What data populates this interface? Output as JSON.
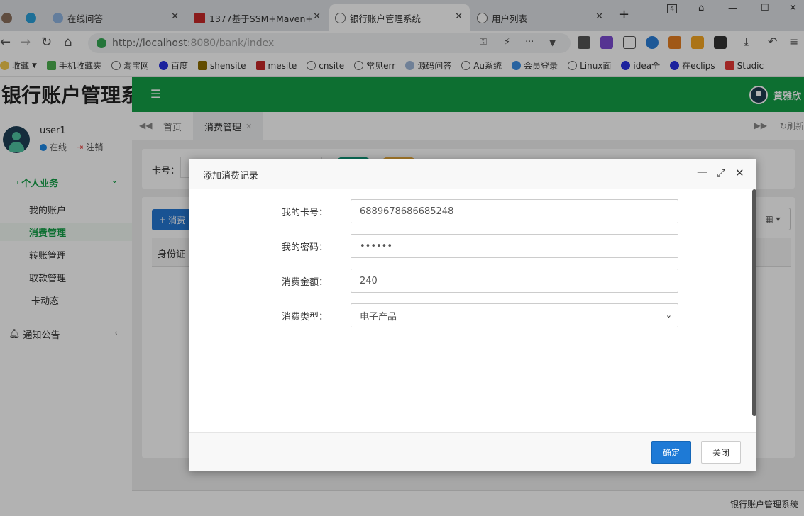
{
  "browser": {
    "tabs": [
      {
        "title": "在线问答"
      },
      {
        "title": "1377基于SSM+Maven+"
      },
      {
        "title": "银行账户管理系统"
      },
      {
        "title": "用户列表"
      }
    ],
    "tab_badge": "4",
    "url_host": "http://localhost",
    "url_rest": ":8080/bank/index",
    "bookmarks": [
      "收藏",
      "手机收藏夹",
      "淘宝网",
      "百度",
      "shensite",
      "mesite",
      "cnsite",
      "常见err",
      "源码问答",
      "Au系统",
      "会员登录",
      "Linux面",
      "idea全",
      "在eclips",
      "Studic"
    ]
  },
  "app": {
    "logo": "银行账户管理系统",
    "current_user": "黄雅欣",
    "colors": {
      "brand_green": "#13a047",
      "primary_blue": "#1e7ad6"
    }
  },
  "sidebar": {
    "username": "user1",
    "status": "在线",
    "logout": "注销",
    "group_label": "个人业务",
    "items": [
      {
        "label": "我的账户"
      },
      {
        "label": "消费管理"
      },
      {
        "label": "转账管理"
      },
      {
        "label": "取款管理"
      },
      {
        "label": "卡动态"
      }
    ],
    "notice_label": "通知公告"
  },
  "content": {
    "tabs": [
      {
        "label": "首页"
      },
      {
        "label": "消费管理"
      }
    ],
    "refresh_label": "刷新",
    "search_label": "卡号：",
    "add_label": "消费",
    "table_header_first": "身份证",
    "footer_text": "银行账户管理系统"
  },
  "modal": {
    "title": "添加消费记录",
    "fields": {
      "card": {
        "label": "我的卡号：",
        "value": "6889678686685248"
      },
      "password": {
        "label": "我的密码：",
        "value": "••••••"
      },
      "amount": {
        "label": "消费金额：",
        "value": "240"
      },
      "type": {
        "label": "消费类型：",
        "value": "电子产品"
      }
    },
    "ok_label": "确定",
    "close_label": "关闭"
  }
}
